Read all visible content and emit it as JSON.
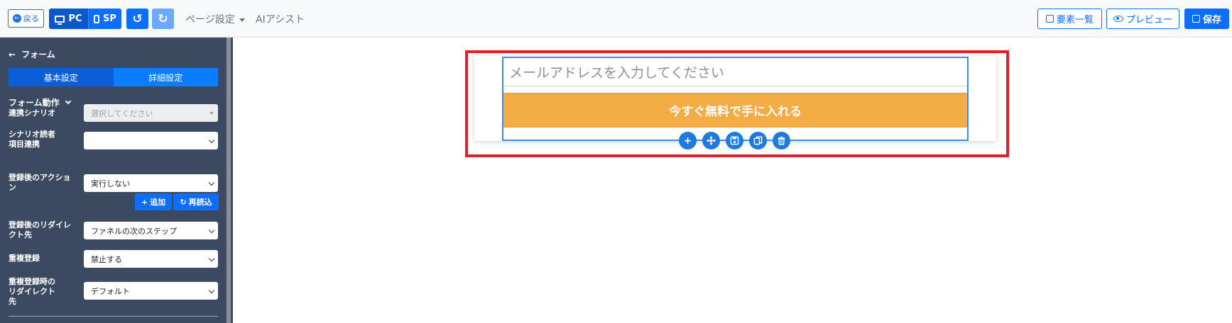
{
  "toolbar": {
    "back_label": "戻る",
    "pc_label": "PC",
    "sp_label": "SP",
    "page_settings_label": "ページ設定",
    "ai_assist_label": "AIアシスト",
    "elements_label": "要素一覧",
    "preview_label": "プレビュー",
    "save_label": "保存"
  },
  "sidebar": {
    "title": "フォーム",
    "tabs": [
      {
        "label": "基本設定"
      },
      {
        "label": "詳細設定"
      }
    ],
    "section_title": "フォーム動作",
    "fields": [
      {
        "label": "連携シナリオ",
        "value": "選択してください"
      },
      {
        "label": "シナリオ読者\n項目連携",
        "value": ""
      },
      {
        "label": "登録後のアクション",
        "value": "実行しない"
      },
      {
        "label": "登録後のリダイレクト先",
        "value": "ファネルの次のステップ"
      },
      {
        "label": "重複登録",
        "value": "禁止する"
      },
      {
        "label": "重複登録時のリダイレクト先",
        "value": "デフォルト"
      }
    ],
    "add_label": "追加",
    "reload_label": "再読込"
  },
  "canvas": {
    "email_placeholder": "メールアドレスを入力してください",
    "cta_label": "今すぐ無料で手に入れる"
  },
  "colors": {
    "primary": "#0d6efd",
    "sidebar_bg": "#3b4a61",
    "cta": "#f4ac45",
    "highlight_frame": "#e0202a"
  }
}
